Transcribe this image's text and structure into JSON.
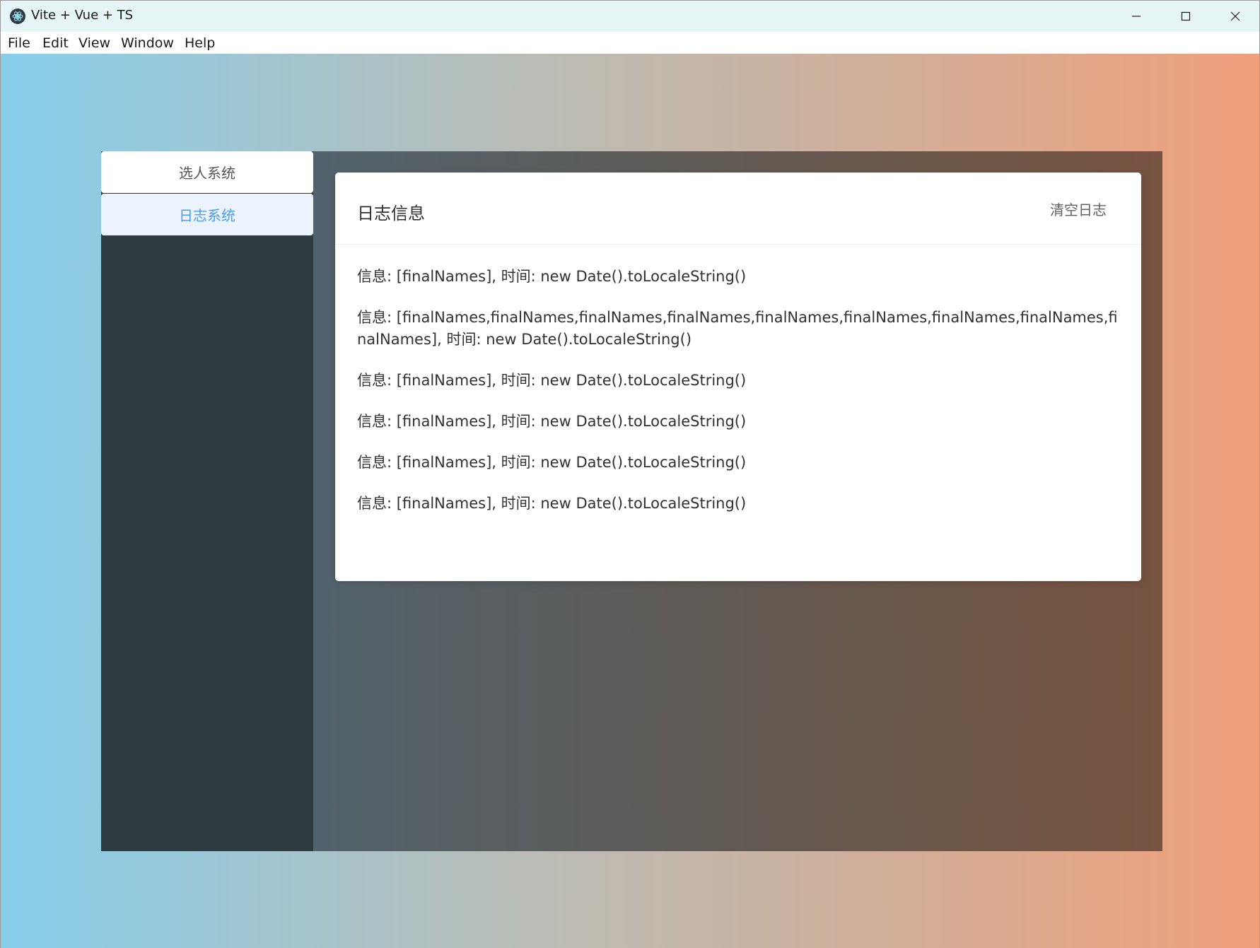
{
  "window": {
    "title": "Vite + Vue + TS",
    "controls": {
      "minimize_icon": "minimize-icon",
      "maximize_icon": "maximize-icon",
      "close_icon": "close-icon"
    }
  },
  "menubar": {
    "items": [
      "File",
      "Edit",
      "View",
      "Window",
      "Help"
    ]
  },
  "sidebar": {
    "items": [
      {
        "label": "选人系统",
        "active": false
      },
      {
        "label": "日志系统",
        "active": true
      }
    ]
  },
  "log_card": {
    "title": "日志信息",
    "clear_button_label": "清空日志",
    "entries": [
      "信息: [finalNames], 时间: new Date().toLocaleString()",
      "信息: [finalNames,finalNames,finalNames,finalNames,finalNames,finalNames,finalNames,finalNames,finalNames], 时间: new Date().toLocaleString()",
      "信息: [finalNames], 时间: new Date().toLocaleString()",
      "信息: [finalNames], 时间: new Date().toLocaleString()",
      "信息: [finalNames], 时间: new Date().toLocaleString()",
      "信息: [finalNames], 时间: new Date().toLocaleString()"
    ]
  },
  "colors": {
    "active_sidebar_text": "#4a9ef0",
    "active_sidebar_bg": "#ebf3fd",
    "sidebar_bg": "#2d3a40"
  }
}
